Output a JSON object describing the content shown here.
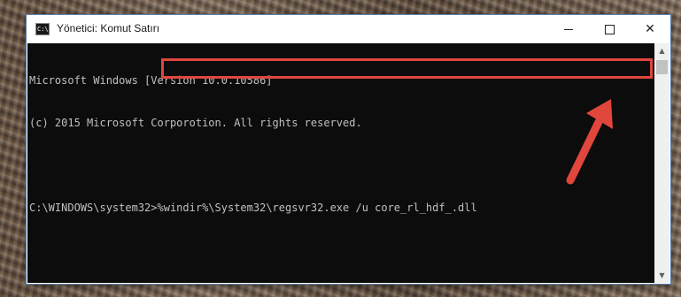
{
  "window": {
    "title": "Yönetici: Komut Satırı",
    "icon": "command-prompt-icon",
    "controls": {
      "minimize": "minimize-icon",
      "maximize": "maximize-icon",
      "close": "close-icon",
      "close_glyph": "✕"
    }
  },
  "console": {
    "lines": [
      "Microsoft Windows [Version 10.0.10586]",
      "(c) 2015 Microsoft Corporotion. All rights reserved.",
      ""
    ],
    "prompt": "C:\\WINDOWS\\system32>",
    "command": "%windir%\\System32\\regsvr32.exe /u core_rl_hdf_.dll"
  },
  "annotation": {
    "highlight_color": "#e0463c",
    "arrow_color": "#e0463c",
    "arrow_icon": "red-arrow-icon"
  },
  "scrollbar": {
    "up_glyph": "▲",
    "down_glyph": "▼"
  }
}
